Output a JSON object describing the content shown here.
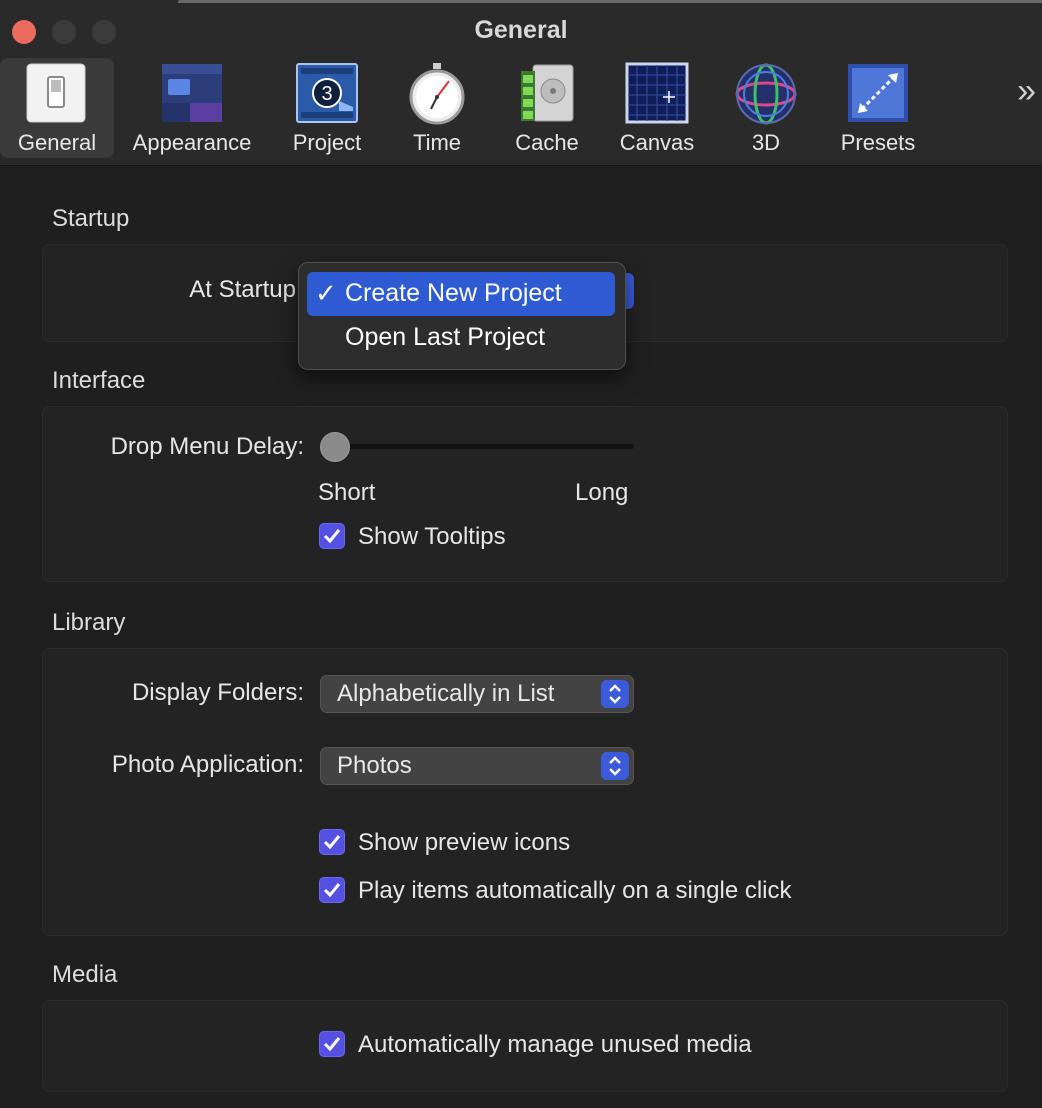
{
  "window": {
    "title": "General"
  },
  "toolbar": {
    "items": [
      {
        "label": "General",
        "icon": "switch-icon"
      },
      {
        "label": "Appearance",
        "icon": "appearance-icon"
      },
      {
        "label": "Project",
        "icon": "film-frame-icon"
      },
      {
        "label": "Time",
        "icon": "stopwatch-icon"
      },
      {
        "label": "Cache",
        "icon": "film-disk-icon"
      },
      {
        "label": "Canvas",
        "icon": "grid-icon"
      },
      {
        "label": "3D",
        "icon": "sphere-icon"
      },
      {
        "label": "Presets",
        "icon": "resize-arrows-icon"
      }
    ],
    "more_icon": "chevron-double-right-icon"
  },
  "startup": {
    "title": "Startup",
    "at_startup_label": "At Startup",
    "menu": {
      "options": [
        "Create New Project",
        "Open Last Project"
      ],
      "selected": "Create New Project",
      "checkmark": "✓"
    }
  },
  "interface": {
    "title": "Interface",
    "drop_menu_delay_label": "Drop Menu Delay:",
    "slider_min_label": "Short",
    "slider_max_label": "Long",
    "slider_value": 0,
    "show_tooltips_label": "Show Tooltips",
    "show_tooltips_checked": true
  },
  "library": {
    "title": "Library",
    "display_folders_label": "Display Folders:",
    "display_folders_value": "Alphabetically in List",
    "photo_app_label": "Photo Application:",
    "photo_app_value": "Photos",
    "show_preview_icons_label": "Show preview icons",
    "play_items_label": "Play items automatically on a single click"
  },
  "media": {
    "title": "Media",
    "manage_unused_label": "Automatically manage unused media"
  },
  "colors": {
    "accent": "#5451e2",
    "menu_highlight": "#2f5bd2",
    "close_button": "#ec6a5e"
  }
}
